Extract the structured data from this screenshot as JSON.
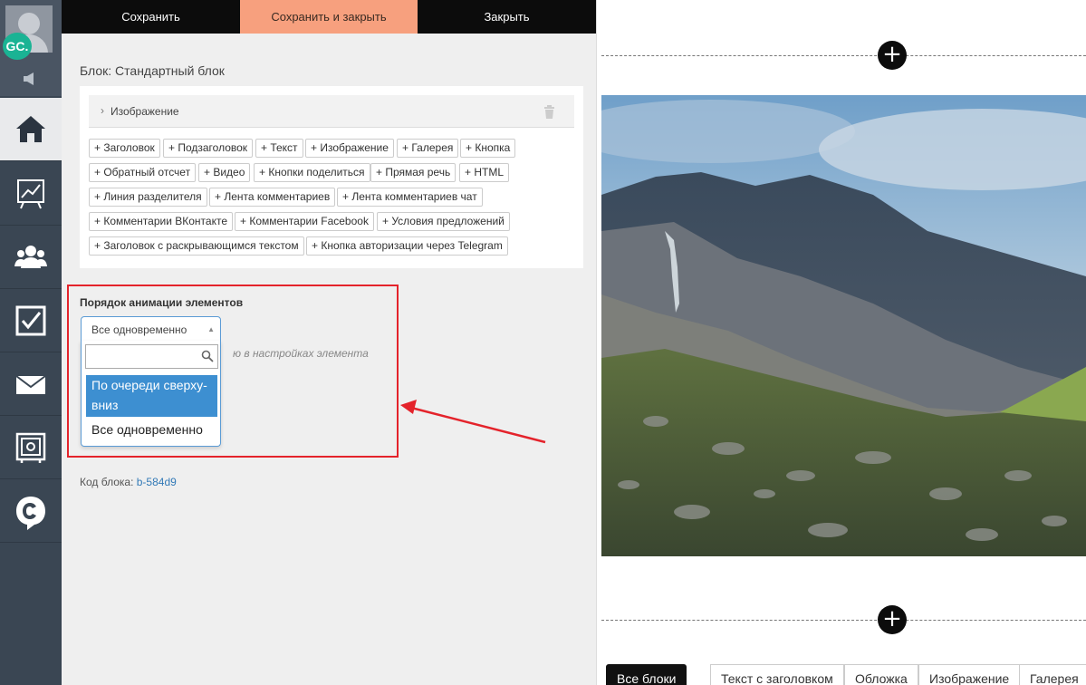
{
  "sidebar": {
    "user_initials": "GC.",
    "items": [
      {
        "icon": "home-icon",
        "active": true
      },
      {
        "icon": "chart-board-icon",
        "active": false
      },
      {
        "icon": "users-icon",
        "active": false
      },
      {
        "icon": "checkbox-icon",
        "active": false
      },
      {
        "icon": "envelope-icon",
        "active": false
      },
      {
        "icon": "safe-icon",
        "active": false
      },
      {
        "icon": "getcourse-logo-icon",
        "active": false
      }
    ]
  },
  "toolbar": {
    "save_label": "Сохранить",
    "save_close_label": "Сохранить и закрыть",
    "close_label": "Закрыть"
  },
  "editor": {
    "block_title": "Блок: Стандартный блок",
    "image_row_label": "Изображение",
    "add_buttons": [
      "+ Заголовок",
      "+ Подзаголовок",
      "+ Текст",
      "+ Изображение",
      "+ Галерея",
      "+ Кнопка",
      "+ Обратный отсчет",
      "+ Видео",
      "+ Кнопки поделиться",
      "+ Прямая речь",
      "+ HTML",
      "+ Линия разделителя",
      "+ Лента комментариев",
      "+ Лента комментариев чат",
      "+ Комментарии ВКонтакте",
      "+ Комментарии Facebook",
      "+ Условия предложений",
      "+ Заголовок с раскрывающимся текстом",
      "+ Кнопка авторизации через Telegram"
    ],
    "animation": {
      "label": "Порядок анимации элементов",
      "selected": "Все одновременно",
      "search_placeholder": "",
      "options": [
        "По очереди сверху-вниз",
        "Все одновременно"
      ],
      "highlighted_option": "По очереди сверху-вниз",
      "hint_partial": "ю в настройках элемента"
    },
    "block_code_label": "Код блока:",
    "block_code_value": "b-584d9"
  },
  "annotation": {
    "color": "#e4232b"
  },
  "preview": {
    "categories": [
      "Все блоки",
      "Текст с заголовком",
      "Обложка",
      "Изображение",
      "Галерея"
    ],
    "active_category": "Все блоки"
  },
  "colors": {
    "sidebar_bg": "#3a4653",
    "accent_orange": "#f7a07e",
    "toolbar_black": "#0c0c0c",
    "selection_blue": "#3d8fd1",
    "badge_green": "#1ab394"
  }
}
